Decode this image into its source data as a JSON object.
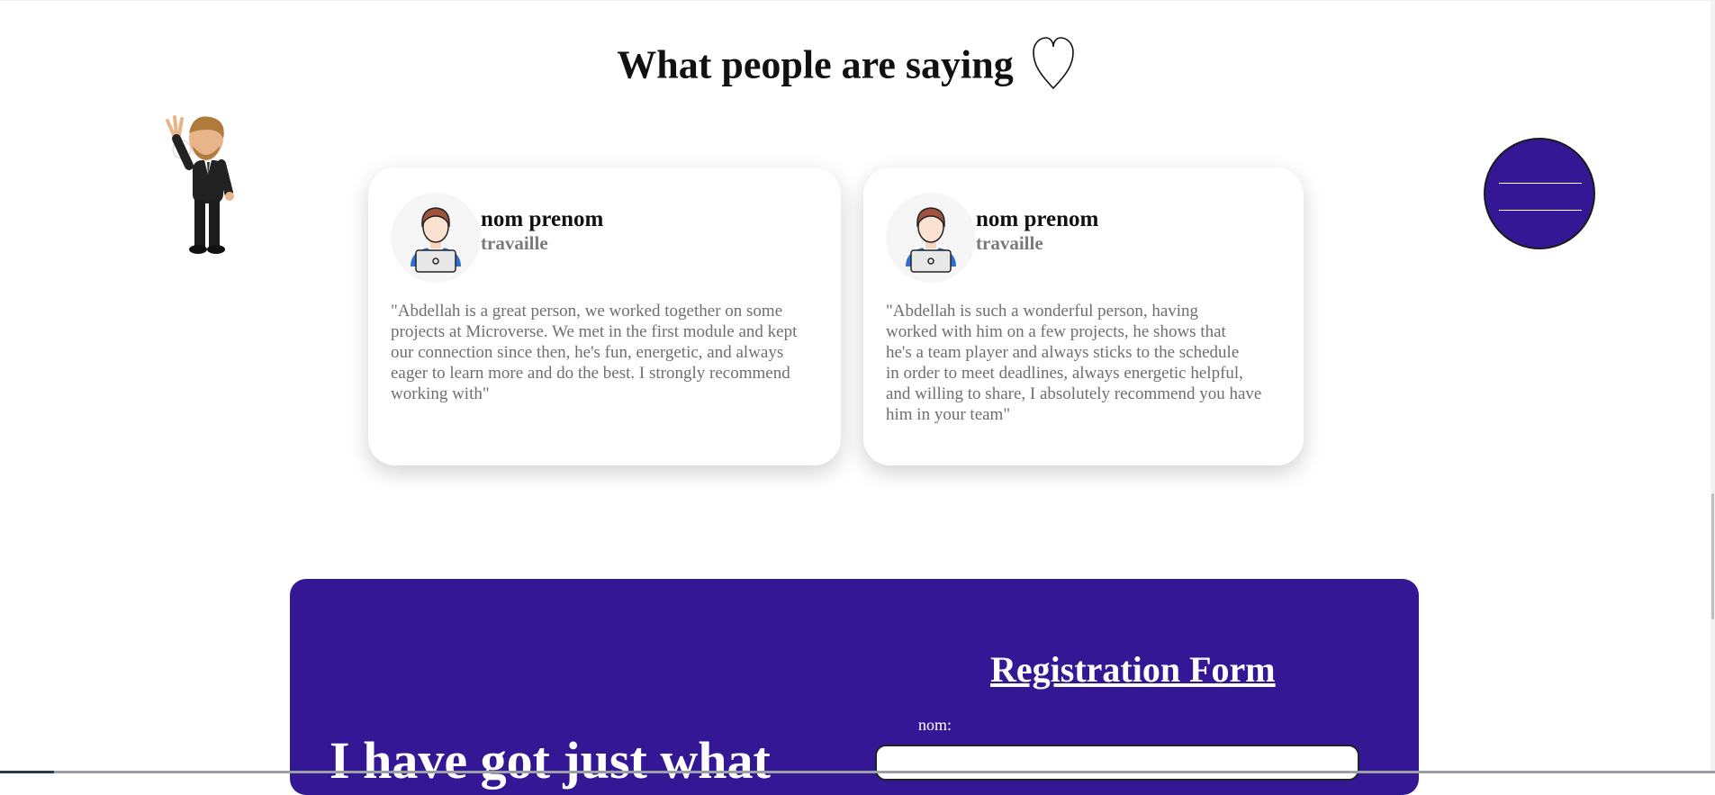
{
  "testimonials": {
    "title": "What people are saying",
    "cards": [
      {
        "name": "nom prenom",
        "role": "travaille",
        "quote_lines": [
          "\"Abdellah is a great person, we worked together on some",
          "projects at Microverse. We met in the first module and kept",
          "our connection since then, he's fun, energetic, and always",
          "eager to learn more and do the best. I strongly recommend",
          "working with\""
        ]
      },
      {
        "name": "nom prenom",
        "role": "travaille",
        "quote_lines": [
          "\"Abdellah is such a wonderful person, having",
          "worked with him on a few projects, he shows that",
          "he's a team player and always sticks to the schedule",
          "in order to meet deadlines, always energetic helpful,",
          "and willing to share, I absolutely recommend you have",
          "him in your team\""
        ]
      }
    ]
  },
  "menu": {
    "icon": "hamburger-menu-icon",
    "color": "#331795"
  },
  "contact": {
    "headline": "I have got just what",
    "form_title": "Registration Form",
    "nom_label": "nom:",
    "background": "#331795"
  }
}
